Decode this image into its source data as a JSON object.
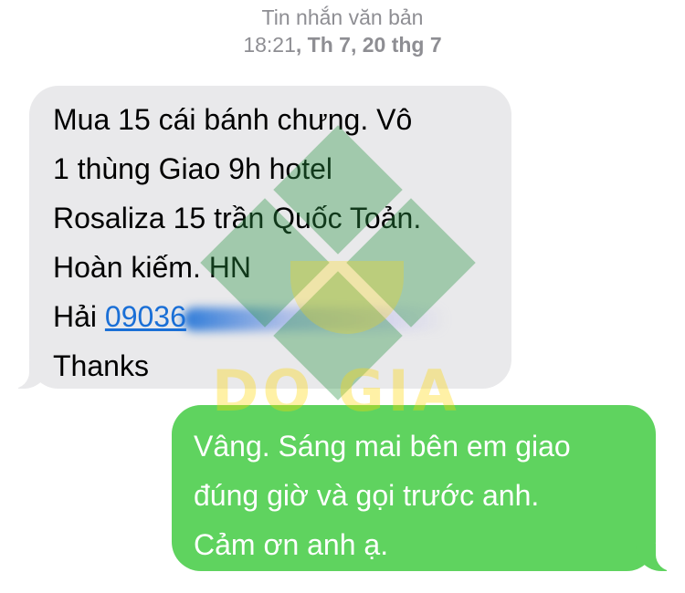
{
  "header": {
    "title": "Tin nhắn văn bản",
    "time": "18:21",
    "date": ", Th 7, 20 thg 7"
  },
  "incoming": {
    "lines": [
      "Mua 15 cái bánh chưng. Vô",
      "1 thùng  Giao 9h hotel",
      "Rosaliza 15 trần Quốc Toản.",
      "Hoàn kiếm. HN"
    ],
    "name_prefix": "Hải ",
    "phone": "09036",
    "thanks": "Thanks"
  },
  "outgoing": {
    "lines": [
      "Vâng. Sáng mai bên em giao",
      "đúng giờ và gọi trước anh.",
      "Cảm ơn anh ạ."
    ]
  },
  "watermark": {
    "text": "DO GIA",
    "colors": {
      "green": "#2e9646",
      "yellow": "#ffd600"
    }
  },
  "colors": {
    "incoming_bg": "#e9e9eb",
    "outgoing_bg": "#5fd35f",
    "link": "#1a6fd6",
    "header_text": "#8e8e93"
  }
}
